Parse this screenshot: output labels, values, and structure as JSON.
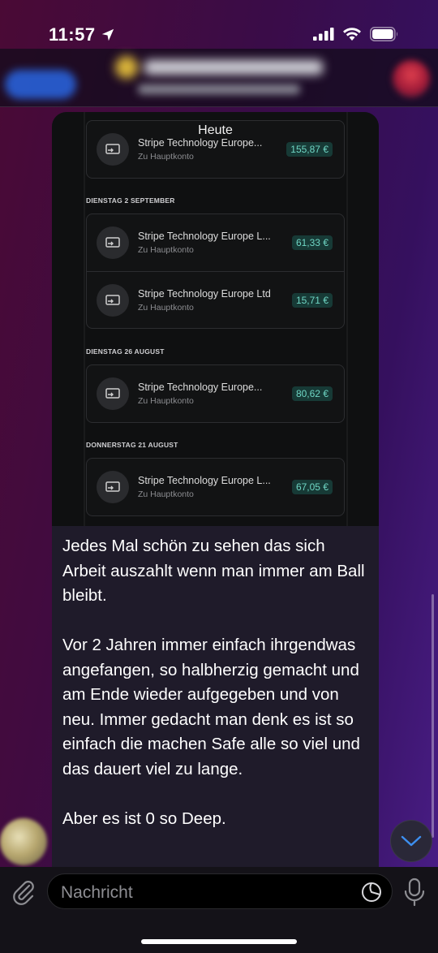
{
  "status_bar": {
    "time": "11:57"
  },
  "chat": {
    "date_separator": "Heute"
  },
  "screenshot": {
    "sections": [
      {
        "label": "",
        "rows": [
          {
            "name": "Stripe Technology Europe...",
            "sub": "Zu Hauptkonto",
            "amount": "155,87 €"
          }
        ]
      },
      {
        "label": "DIENSTAG 2 SEPTEMBER",
        "rows": [
          {
            "name": "Stripe Technology Europe L...",
            "sub": "Zu Hauptkonto",
            "amount": "61,33 €"
          },
          {
            "name": "Stripe Technology Europe Ltd",
            "sub": "Zu Hauptkonto",
            "amount": "15,71 €"
          }
        ]
      },
      {
        "label": "DIENSTAG 26 AUGUST",
        "rows": [
          {
            "name": "Stripe Technology Europe...",
            "sub": "Zu Hauptkonto",
            "amount": "80,62 €"
          }
        ]
      },
      {
        "label": "DONNERSTAG 21 AUGUST",
        "rows": [
          {
            "name": "Stripe Technology Europe L...",
            "sub": "Zu Hauptkonto",
            "amount": "67,05 €"
          }
        ]
      }
    ]
  },
  "message": {
    "paragraph_1": "Jedes Mal schön zu sehen das sich Arbeit auszahlt wenn man immer am Ball bleibt.",
    "paragraph_2": "Vor 2 Jahren immer einfach ihrgendwas angefangen, so halbherzig gemacht und am Ende wieder aufgegeben und von neu. Immer gedacht man denk es ist so einfach die machen Safe alle so viel und das dauert viel zu lange.",
    "paragraph_3": "Aber es ist 0 so Deep."
  },
  "composer": {
    "placeholder": "Nachricht"
  },
  "colors": {
    "amount_text": "#6fd6c4",
    "amount_bg": "#173a36",
    "accent_blue": "#2a6cf0"
  },
  "icons": [
    "location-arrow-icon",
    "signal-icon",
    "wifi-icon",
    "battery-icon",
    "transfer-icon",
    "chevron-down-icon",
    "paperclip-icon",
    "sticker-icon",
    "microphone-icon"
  ]
}
